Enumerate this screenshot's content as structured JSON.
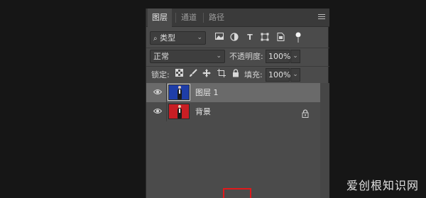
{
  "tabs": [
    {
      "label": "图层",
      "active": true
    },
    {
      "label": "通道",
      "active": false
    },
    {
      "label": "路径",
      "active": false
    }
  ],
  "filter": {
    "kind_label": "类型",
    "icons": [
      "image-filter-icon",
      "adjustment-filter-icon",
      "type-filter-icon",
      "shape-filter-icon",
      "smart-object-filter-icon",
      "filter-toggle-icon"
    ]
  },
  "blend": {
    "mode": "正常",
    "opacity_label": "不透明度:",
    "opacity_value": "100%"
  },
  "lock": {
    "label": "锁定:",
    "fill_label": "填充:",
    "fill_value": "100%",
    "icons": [
      "lock-transparent-pixels-icon",
      "lock-image-pixels-icon",
      "lock-position-icon",
      "lock-artboard-icon",
      "lock-all-icon"
    ]
  },
  "layers": [
    {
      "name": "图层 1",
      "selected": true,
      "thumb_color": "#1f3ea8",
      "locked": false,
      "visible": true
    },
    {
      "name": "背景",
      "selected": false,
      "thumb_color": "#c81e24",
      "locked": true,
      "visible": true
    }
  ],
  "colors": {
    "panel_bg": "#4b4b4b",
    "selected_row": "#6a6a6a",
    "highlight_box": "#e0191b"
  },
  "watermark": "爱创根知识网"
}
